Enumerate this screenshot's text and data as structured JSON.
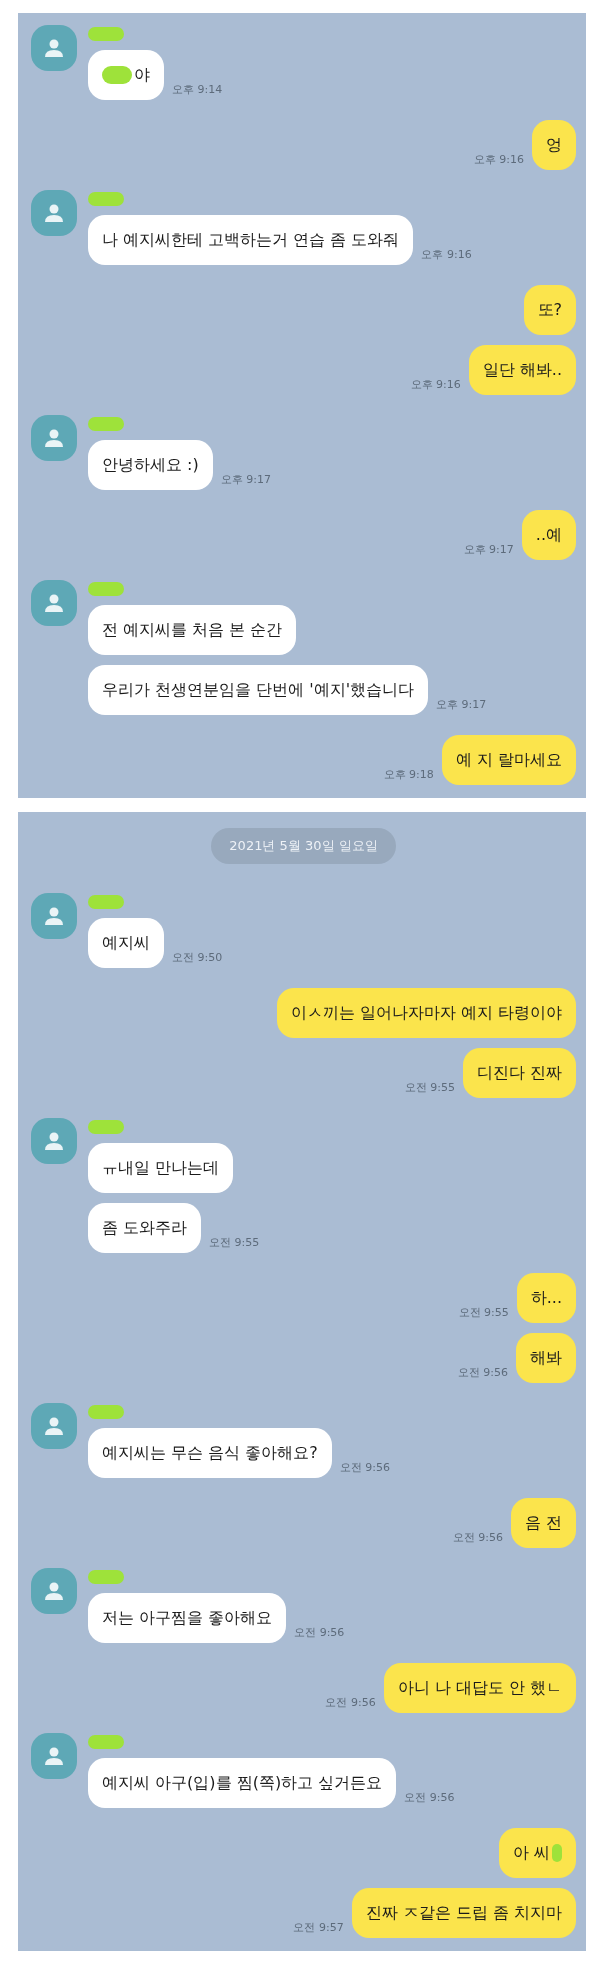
{
  "panels": [
    {
      "messages": [
        {
          "kind": "received",
          "first": true,
          "name_redacted": true,
          "text": "야",
          "redacted_start": true,
          "time": "오후 9:14"
        },
        {
          "kind": "sent",
          "text": "엉",
          "time": "오후 9:16"
        },
        {
          "kind": "received",
          "first": true,
          "name_redacted": true,
          "text": "나 예지씨한테 고백하는거 연습 좀 도와줘",
          "time": "오후 9:16"
        },
        {
          "kind": "sent",
          "text": "또?"
        },
        {
          "kind": "sent",
          "text": "일단 해봐..",
          "time": "오후 9:16"
        },
        {
          "kind": "received",
          "first": true,
          "name_redacted": true,
          "text": "안녕하세요 :)",
          "time": "오후 9:17"
        },
        {
          "kind": "sent",
          "text": "..예",
          "time": "오후 9:17"
        },
        {
          "kind": "received",
          "first": true,
          "name_redacted": true,
          "text": "전 예지씨를 처음 본 순간"
        },
        {
          "kind": "received",
          "text": "우리가 천생연분임을 단번에 '예지'했습니다",
          "time": "오후 9:17"
        },
        {
          "kind": "sent",
          "text": "예 지 랄마세요",
          "time": "오후 9:18"
        }
      ]
    },
    {
      "date": "2021년 5월 30일 일요일",
      "messages": [
        {
          "kind": "received",
          "first": true,
          "name_redacted": true,
          "text": "예지씨",
          "time": "오전 9:50"
        },
        {
          "kind": "sent",
          "text": "이ㅅ끼는 일어나자마자 예지 타령이야"
        },
        {
          "kind": "sent",
          "text": "디진다 진짜",
          "time": "오전 9:55"
        },
        {
          "kind": "received",
          "first": true,
          "name_redacted": true,
          "text": "ㅠ내일 만나는데"
        },
        {
          "kind": "received",
          "text": "좀 도와주라",
          "time": "오전 9:55"
        },
        {
          "kind": "sent",
          "text": "하...",
          "time": "오전 9:55"
        },
        {
          "kind": "sent",
          "text": "해봐",
          "time": "오전 9:56"
        },
        {
          "kind": "received",
          "first": true,
          "name_redacted": true,
          "text": "예지씨는 무슨 음식 좋아해요?",
          "time": "오전 9:56"
        },
        {
          "kind": "sent",
          "text": "음 전",
          "time": "오전 9:56"
        },
        {
          "kind": "received",
          "first": true,
          "name_redacted": true,
          "text": "저는 아구찜을 좋아해요",
          "time": "오전 9:56"
        },
        {
          "kind": "sent",
          "text": "아니 나 대답도 안 했ㄴ",
          "time": "오전 9:56"
        },
        {
          "kind": "received",
          "first": true,
          "name_redacted": true,
          "text": "예지씨 아구(입)를 찜(쪽)하고 싶거든요",
          "time": "오전 9:56"
        },
        {
          "kind": "sent",
          "text": "아 씨",
          "redacted_end": true
        },
        {
          "kind": "sent",
          "text": "진짜 ㅈ같은 드립 좀 치지마",
          "time": "오전 9:57"
        }
      ]
    }
  ]
}
